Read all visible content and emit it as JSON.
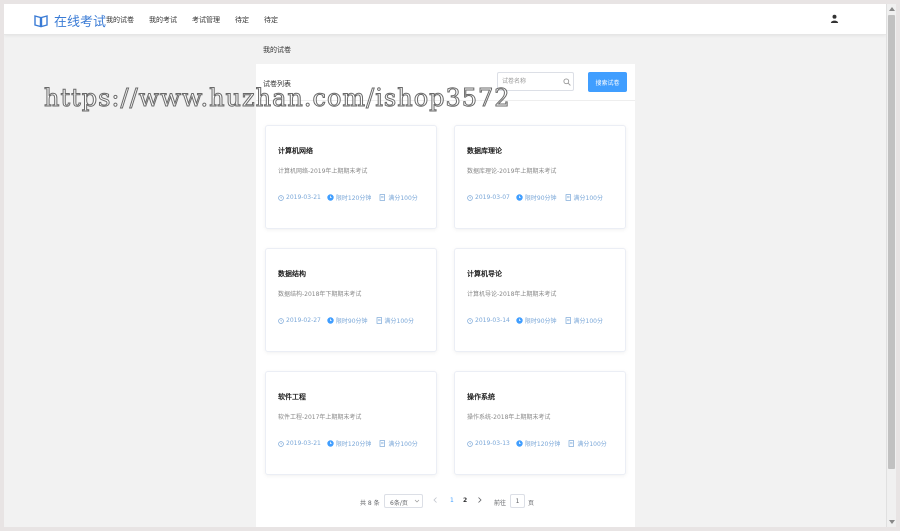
{
  "header": {
    "app_title": "在线考试",
    "nav": [
      "我的试卷",
      "我的考试",
      "考试管理",
      "待定",
      "待定"
    ]
  },
  "page": {
    "title": "我的试卷"
  },
  "panel": {
    "title": "试卷列表",
    "search_placeholder": "试卷名称",
    "search_button": "搜索试卷"
  },
  "cards": [
    {
      "title": "计算机网络",
      "desc": "计算机网络-2019年上期期末考试",
      "date": "2019-03-21",
      "time": "限时120分钟",
      "score": "满分100分"
    },
    {
      "title": "数据库理论",
      "desc": "数据库理论-2019年上期期末考试",
      "date": "2019-03-07",
      "time": "限时90分钟",
      "score": "满分100分"
    },
    {
      "title": "数据结构",
      "desc": "数据结构-2018年下期期末考试",
      "date": "2019-02-27",
      "time": "限时90分钟",
      "score": "满分100分"
    },
    {
      "title": "计算机导论",
      "desc": "计算机导论-2018年上期期末考试",
      "date": "2019-03-14",
      "time": "限时90分钟",
      "score": "满分100分"
    },
    {
      "title": "软件工程",
      "desc": "软件工程-2017年上期期末考试",
      "date": "2019-03-21",
      "time": "限时120分钟",
      "score": "满分100分"
    },
    {
      "title": "操作系统",
      "desc": "操作系统-2018年上期期末考试",
      "date": "2019-03-13",
      "time": "限时120分钟",
      "score": "满分100分"
    }
  ],
  "pagination": {
    "total": "共 8 条",
    "page_size": "6条/页",
    "pages": [
      "1",
      "2"
    ],
    "goto_label": "前往",
    "goto_value": "1",
    "page_unit": "页"
  },
  "watermark": "https://www.huzhan.com/ishop3572",
  "colors": {
    "accent": "#409eff",
    "logo": "#3a7bd5",
    "meta": "#7aa7d8"
  }
}
